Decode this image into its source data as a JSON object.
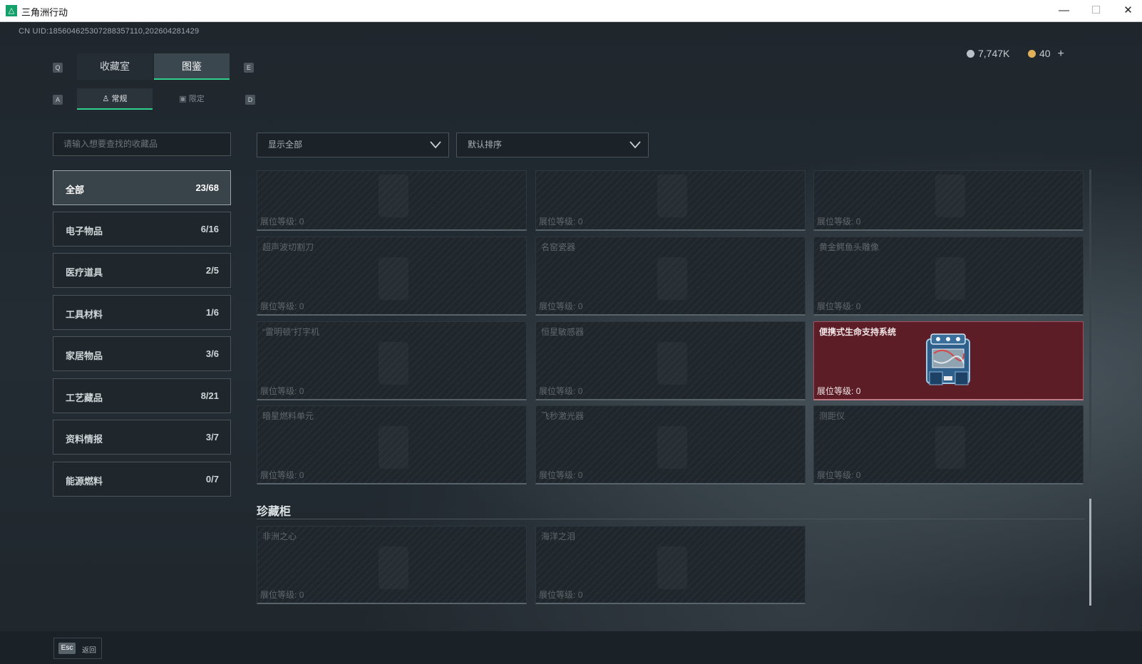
{
  "window": {
    "title": "三角洲行动",
    "minimize": "—",
    "maximize": "☐",
    "close": "✕"
  },
  "uid": "CN UID:185604625307288357110,202604281429",
  "currency": [
    {
      "value": "7,747K",
      "color": "#b9c2c8"
    },
    {
      "value": "40",
      "color": "#e0b15a"
    }
  ],
  "currency_add": "+",
  "key_hints": {
    "tab_prev": "Q",
    "tab_next": "E",
    "sub_prev": "A",
    "sub_next": "D"
  },
  "tabs": [
    "收藏室",
    "图鉴"
  ],
  "subtabs": [
    {
      "label": "常规",
      "icon": "figure-icon"
    },
    {
      "label": "限定",
      "icon": "image-icon"
    }
  ],
  "search": {
    "placeholder": "请输入想要查找的收藏品"
  },
  "categories": [
    {
      "label": "全部",
      "count": "23/68"
    },
    {
      "label": "电子物品",
      "count": "6/16"
    },
    {
      "label": "医疗道具",
      "count": "2/5"
    },
    {
      "label": "工具材料",
      "count": "1/6"
    },
    {
      "label": "家居物品",
      "count": "3/6"
    },
    {
      "label": "工艺藏品",
      "count": "8/21"
    },
    {
      "label": "资料情报",
      "count": "3/7"
    },
    {
      "label": "能源燃料",
      "count": "0/7"
    }
  ],
  "filters": {
    "filter": "显示全部",
    "sort": "默认排序"
  },
  "level_label": "展位等级:",
  "items": [
    {
      "name": "",
      "level": "0",
      "owned": false
    },
    {
      "name": "",
      "level": "0",
      "owned": false
    },
    {
      "name": "",
      "level": "0",
      "owned": false
    },
    {
      "name": "超声波切割刀",
      "level": "0",
      "owned": false
    },
    {
      "name": "名窑瓷器",
      "level": "0",
      "owned": false
    },
    {
      "name": "黄金鳄鱼头雕像",
      "level": "0",
      "owned": false
    },
    {
      "name": "“雷明顿”打字机",
      "level": "0",
      "owned": false
    },
    {
      "name": "恒星敏感器",
      "level": "0",
      "owned": false
    },
    {
      "name": "便携式生命支持系统",
      "level": "0",
      "owned": true
    },
    {
      "name": "暗星燃料单元",
      "level": "0",
      "owned": false
    },
    {
      "name": "飞秒激光器",
      "level": "0",
      "owned": false
    },
    {
      "name": "测距仪",
      "level": "0",
      "owned": false
    }
  ],
  "section": {
    "title": "珍藏柜"
  },
  "treasures": [
    {
      "name": "非洲之心",
      "level": "0"
    },
    {
      "name": "海洋之泪",
      "level": "0"
    }
  ],
  "footer": {
    "key": "Esc",
    "label": "返回"
  }
}
